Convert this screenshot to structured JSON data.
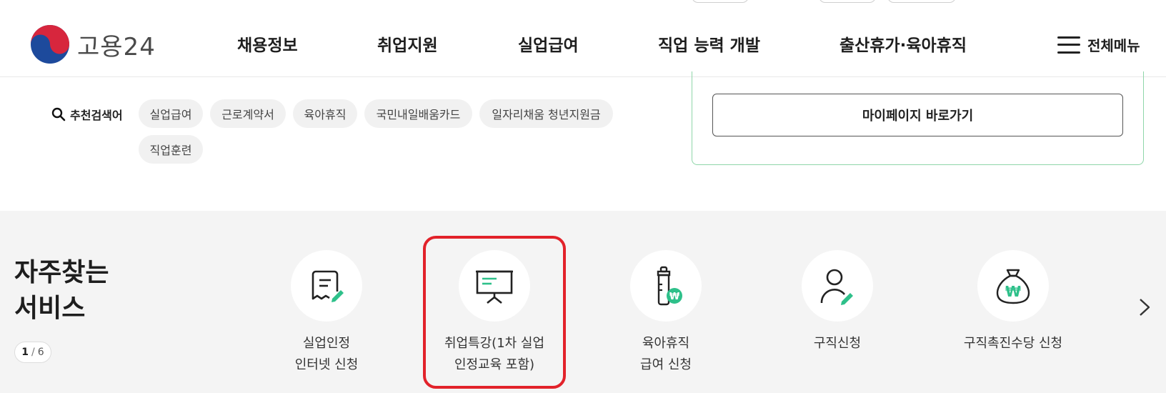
{
  "header": {
    "logo_text": "고용24",
    "nav": [
      {
        "label": "채용정보"
      },
      {
        "label": "취업지원"
      },
      {
        "label": "실업급여"
      },
      {
        "label": "직업 능력 개발"
      },
      {
        "label": "출산휴가·육아휴직"
      }
    ],
    "all_menu_label": "전체메뉴"
  },
  "search": {
    "label": "추천검색어",
    "chips": [
      "실업급여",
      "근로계약서",
      "육아휴직",
      "국민내일배움카드",
      "일자리채움 청년지원금",
      "직업훈련"
    ]
  },
  "mypage": {
    "button_label": "마이페이지 바로가기"
  },
  "services": {
    "title_line1": "자주찾는",
    "title_line2": "서비스",
    "pager_current": "1",
    "pager_sep": "/",
    "pager_total": "6",
    "items": [
      {
        "label": "실업인정\n인터넷 신청",
        "icon": "document-edit-icon"
      },
      {
        "label": "취업특강(1차 실업\n인정교육 포함)",
        "icon": "presentation-board-icon"
      },
      {
        "label": "육아휴직\n급여 신청",
        "icon": "baby-bottle-won-icon"
      },
      {
        "label": "구직신청",
        "icon": "person-edit-icon"
      },
      {
        "label": "구직촉진수당 신청",
        "icon": "money-bag-won-icon"
      }
    ],
    "highlighted_index": 1
  },
  "colors": {
    "accent_green": "#2ec08a",
    "highlight_red": "#e2222a",
    "box_border_green": "#8fd6a9"
  }
}
